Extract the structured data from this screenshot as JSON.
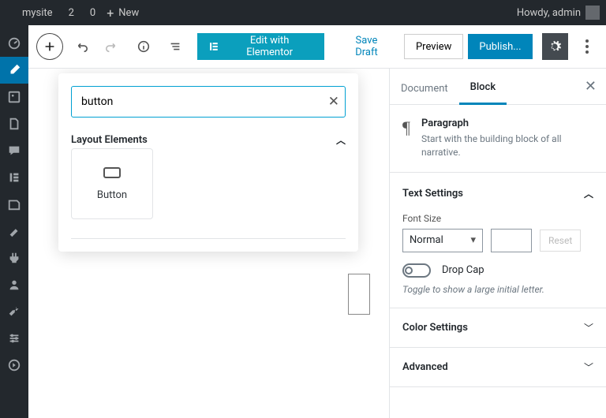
{
  "adminbar": {
    "site": "mysite",
    "updates": "2",
    "comments": "0",
    "new": "New",
    "greeting": "Howdy, admin"
  },
  "toolbar": {
    "elementor": "Edit with Elementor",
    "save_draft": "Save Draft",
    "preview": "Preview",
    "publish": "Publish..."
  },
  "inserter": {
    "search_value": "button",
    "category": "Layout Elements",
    "block": "Button"
  },
  "sidebar": {
    "tabs": {
      "document": "Document",
      "block": "Block"
    },
    "para": {
      "title": "Paragraph",
      "desc": "Start with the building block of all narrative."
    },
    "text_settings": {
      "title": "Text Settings",
      "font_label": "Font Size",
      "font_value": "Normal",
      "reset": "Reset",
      "dropcap": "Drop Cap",
      "dropcap_hint": "Toggle to show a large initial letter."
    },
    "color_settings": "Color Settings",
    "advanced": "Advanced"
  }
}
